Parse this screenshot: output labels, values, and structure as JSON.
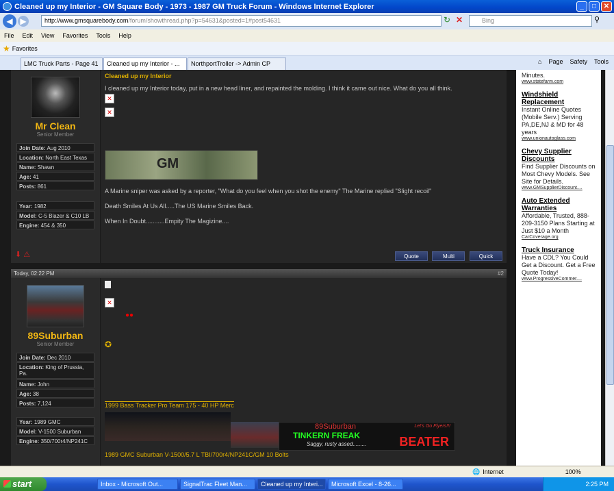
{
  "window": {
    "title": "Cleaned up my Interior - GM Square Body - 1973 - 1987 GM Truck Forum - Windows Internet Explorer"
  },
  "address": {
    "domain": "http://www.gmsquarebody.com",
    "path": "/forum/showthread.php?p=54631&posted=1#post54631"
  },
  "search": {
    "placeholder": "Bing"
  },
  "menu": [
    "File",
    "Edit",
    "View",
    "Favorites",
    "Tools",
    "Help"
  ],
  "favorites_label": "Favorites",
  "tabs": [
    {
      "label": "LMC Truck Parts - Page 41"
    },
    {
      "label": "Cleaned up my Interior - ..."
    },
    {
      "label": "NorthportTroller -> Admin CP"
    }
  ],
  "tools": {
    "page": "Page",
    "safety": "Safety",
    "tools": "Tools"
  },
  "post1": {
    "title": "Cleaned up my Interior",
    "user": "Mr Clean",
    "user_title": "Senior Member",
    "info": [
      {
        "k": "Join Date:",
        "v": "Aug 2010"
      },
      {
        "k": "Location:",
        "v": "North East Texas"
      },
      {
        "k": "Name:",
        "v": "Shawn"
      },
      {
        "k": "Age:",
        "v": "41"
      },
      {
        "k": "Posts:",
        "v": "861"
      }
    ],
    "info2": [
      {
        "k": "Year:",
        "v": "1982"
      },
      {
        "k": "Model:",
        "v": "C-5 Blazer & C10 LB"
      },
      {
        "k": "Engine:",
        "v": "454 & 350"
      }
    ],
    "message": "I cleaned up my Interior today, put in a new head liner, and repainted the molding. I think it came out nice. What do you all think.",
    "banner_text": "GM",
    "sig1": "A Marine sniper was asked by a reporter, \"What do you feel when you shot the enemy\" The Marine replied \"Slight recoil\"",
    "sig2": "Death Smiles At Us All.....The US Marine Smiles Back.",
    "sig3": "When In Doubt...........Empity The Magizine....",
    "buttons": {
      "quote": "Quote",
      "multi": "Multi",
      "quick": "Quick"
    }
  },
  "post2": {
    "date": "Today, 02:22 PM",
    "num": "#2",
    "user": "89Suburban",
    "user_title": "Senior Member",
    "info": [
      {
        "k": "Join Date:",
        "v": "Dec 2010"
      },
      {
        "k": "Location:",
        "v": "King of Prussia, Pa."
      },
      {
        "k": "Name:",
        "v": "John"
      },
      {
        "k": "Age:",
        "v": "38"
      },
      {
        "k": "Posts:",
        "v": "7,124"
      }
    ],
    "info2": [
      {
        "k": "Year:",
        "v": "1989 GMC"
      },
      {
        "k": "Model:",
        "v": "V-1500 Suburban"
      },
      {
        "k": "Engine:",
        "v": "350/700r4/NP241C"
      }
    ],
    "sig_line1": "1999 Bass Tracker Pro Team 175 - 40 HP Merc",
    "sig_line2": "1989 GMC Suburban V-1500/5.7 L TBI/700r4/NP241C/GM 10 Bolts",
    "banner": {
      "top": "89Suburban",
      "mid": "TINKERN FREAK",
      "sub": "Saggy, rusty assed.........",
      "big": "BEATER",
      "corner": "Let's Go Flyers!!!"
    }
  },
  "ads": [
    {
      "lead": "Minutes.",
      "url": "www.statefarm.com"
    },
    {
      "title": "Windshield Replacement",
      "desc": "Instant Online Quotes (Mobile Serv.) Serving PA,DE,NJ & MD for 48 years",
      "url": "www.unionautoglass.com"
    },
    {
      "title": "Chevy Supplier Discounts",
      "desc": "Find Supplier Discounts on Most Chevy Models. See Site for Details.",
      "url": "www.GMSupplierDiscount...."
    },
    {
      "title": "Auto Extended Warranties",
      "desc": "Affordable, Trusted, 888-209-3150 Plans Starting at Just $10 a Month",
      "url": "CarCoverage.org"
    },
    {
      "title": "Truck Insurance",
      "desc": "Have a CDL? You Could Get a Discount. Get a Free Quote Today!",
      "url": "www.ProgressiveCommer...."
    }
  ],
  "status": {
    "zone": "Internet",
    "zoom": "100%"
  },
  "taskbar": {
    "start": "start",
    "items": [
      "Inbox - Microsoft Out...",
      "SignalTrac Fleet Man...",
      "Cleaned up my Interi...",
      "Microsoft Excel - 8-26..."
    ],
    "clock": "2:25 PM"
  }
}
